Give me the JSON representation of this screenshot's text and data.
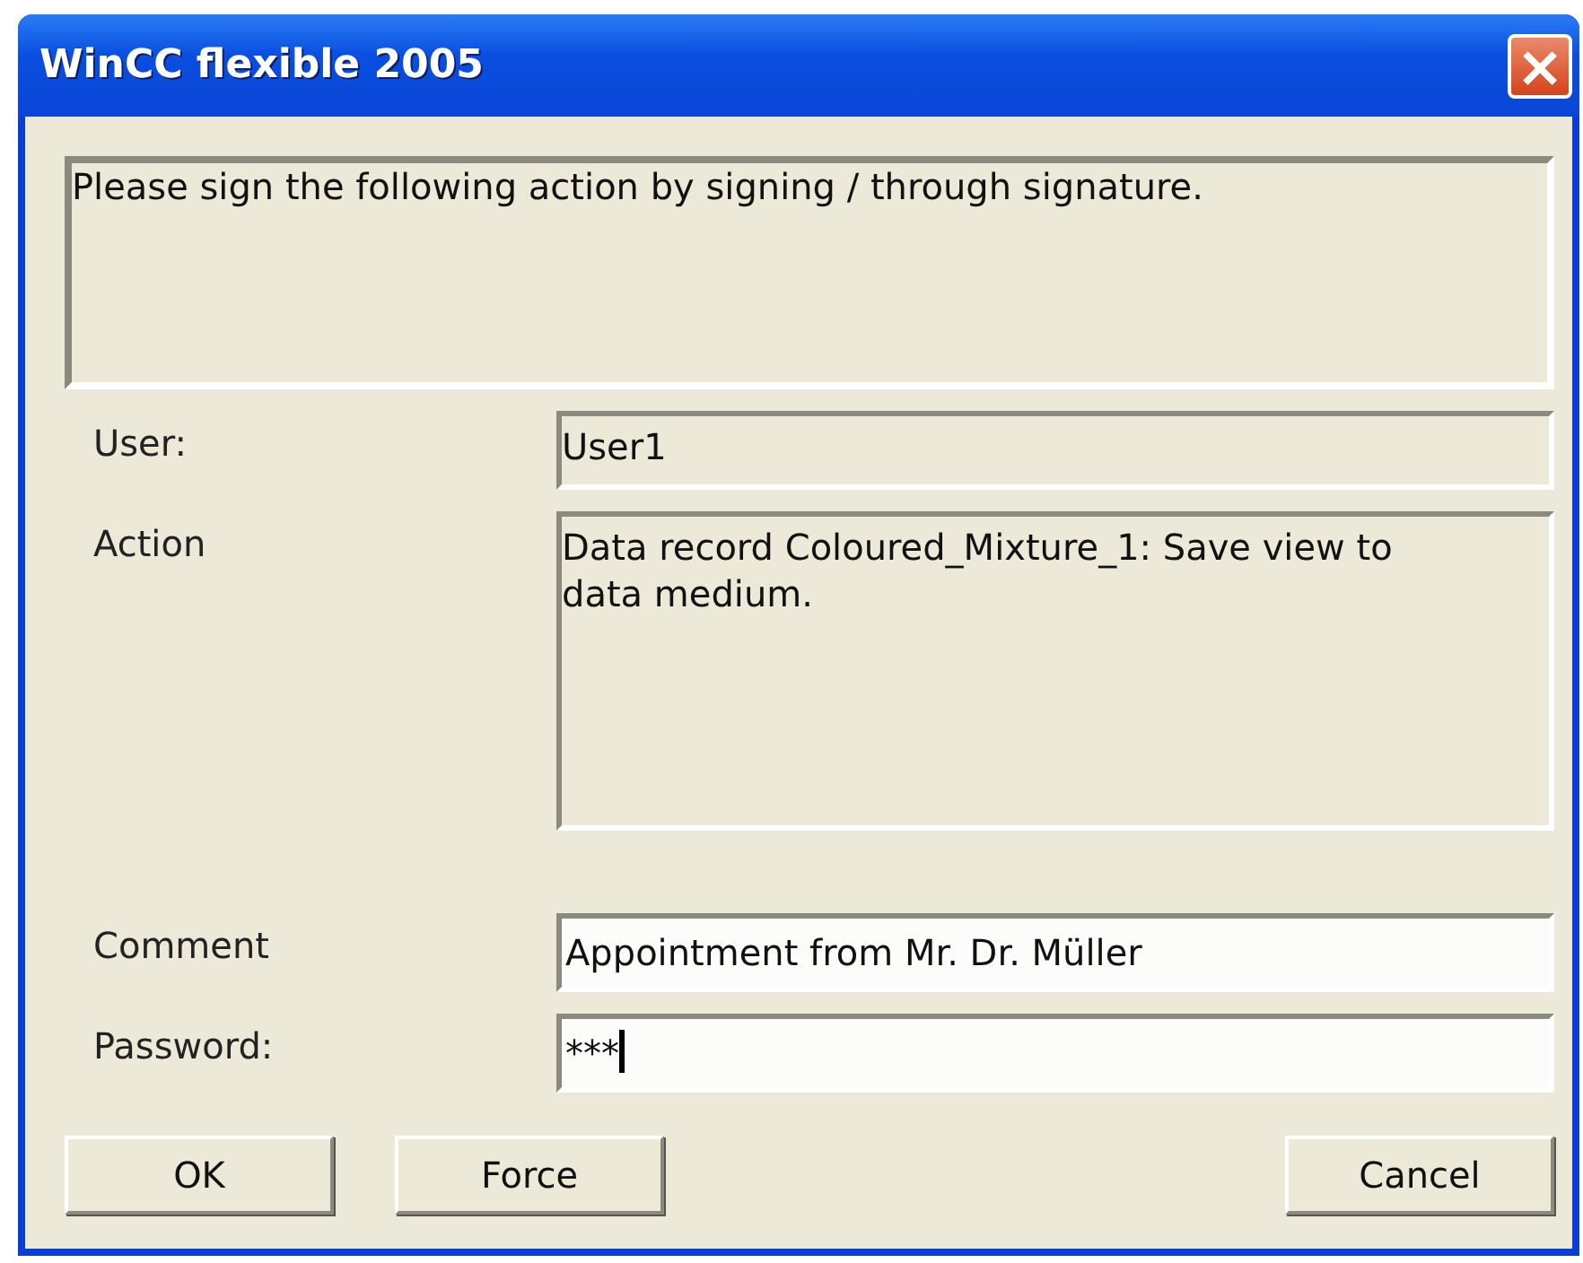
{
  "window": {
    "title": "WinCC flexible 2005",
    "close": "×"
  },
  "message": "Please sign the following action by signing / through signature.",
  "fields": [
    {
      "label": "User:",
      "value": "User1",
      "readonly": true,
      "kind": "single",
      "focused": false
    },
    {
      "label": "Action",
      "value": "Data record Coloured_Mixture_1: Save view to data medium.",
      "readonly": true,
      "kind": "multi",
      "focused": false
    },
    {
      "label": "Comment",
      "value": "Appointment from Mr. Dr. Müller",
      "readonly": false,
      "kind": "single",
      "focused": false
    },
    {
      "label": "Password:",
      "value": "***",
      "readonly": false,
      "kind": "single",
      "focused": true
    }
  ],
  "left_buttons": [
    "OK",
    "Force"
  ],
  "right_buttons": [
    "Cancel"
  ]
}
